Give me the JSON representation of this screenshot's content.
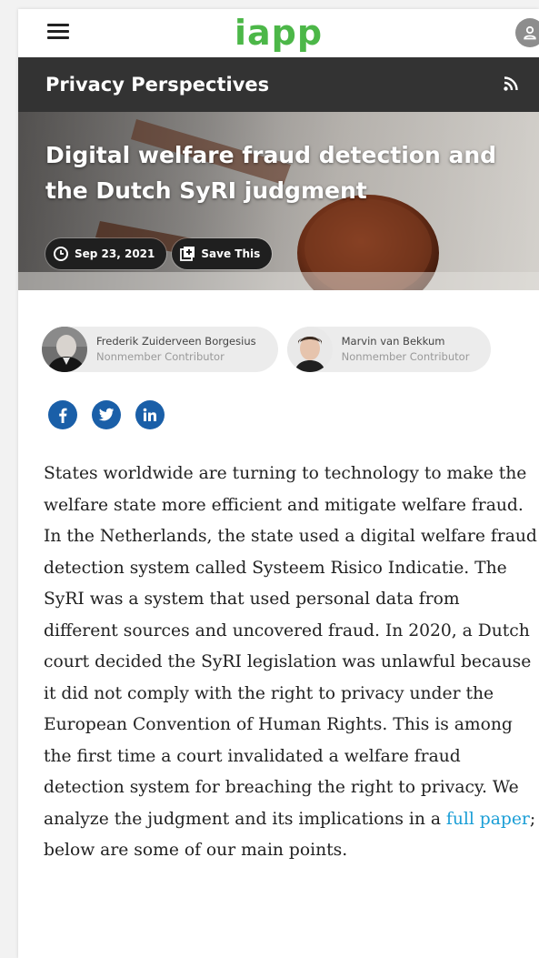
{
  "header": {
    "logo": "iapp",
    "menu_icon": "hamburger-menu-icon",
    "user_icon": "user-icon"
  },
  "section": {
    "title": "Privacy Perspectives",
    "rss_icon": "rss-icon"
  },
  "hero": {
    "title": "Digital welfare fraud detection and the Dutch SyRI judgment",
    "date": "Sep 23, 2021",
    "save_label": "Save This"
  },
  "authors": [
    {
      "name": "Frederik Zuiderveen Borgesius",
      "role": "Nonmember Contributor"
    },
    {
      "name": "Marvin van Bekkum",
      "role": "Nonmember Contributor"
    }
  ],
  "social": [
    "facebook-icon",
    "twitter-icon",
    "linkedin-icon"
  ],
  "article": {
    "text_before_link": "States worldwide are turning to technology to make the welfare state more efficient and mitigate welfare fraud. In the Netherlands, the state used a digital welfare fraud detection system called Systeem Risico Indicatie. The SyRI was a system that used personal data from different sources and uncovered fraud. In 2020, a Dutch court decided the SyRI legislation was unlawful because it did not comply with the right to privacy under the European Convention of Human Rights. This is among the first time a court invalidated a welfare fraud detection system for breaching the right to privacy. We analyze the judgment and its implications in a ",
    "link_text": "full paper",
    "text_after_link": "; below are some of our main points."
  },
  "colors": {
    "brand_green": "#4cb748",
    "section_bar": "#333333",
    "link": "#1a9ed6",
    "social": "#1a5fa8"
  }
}
